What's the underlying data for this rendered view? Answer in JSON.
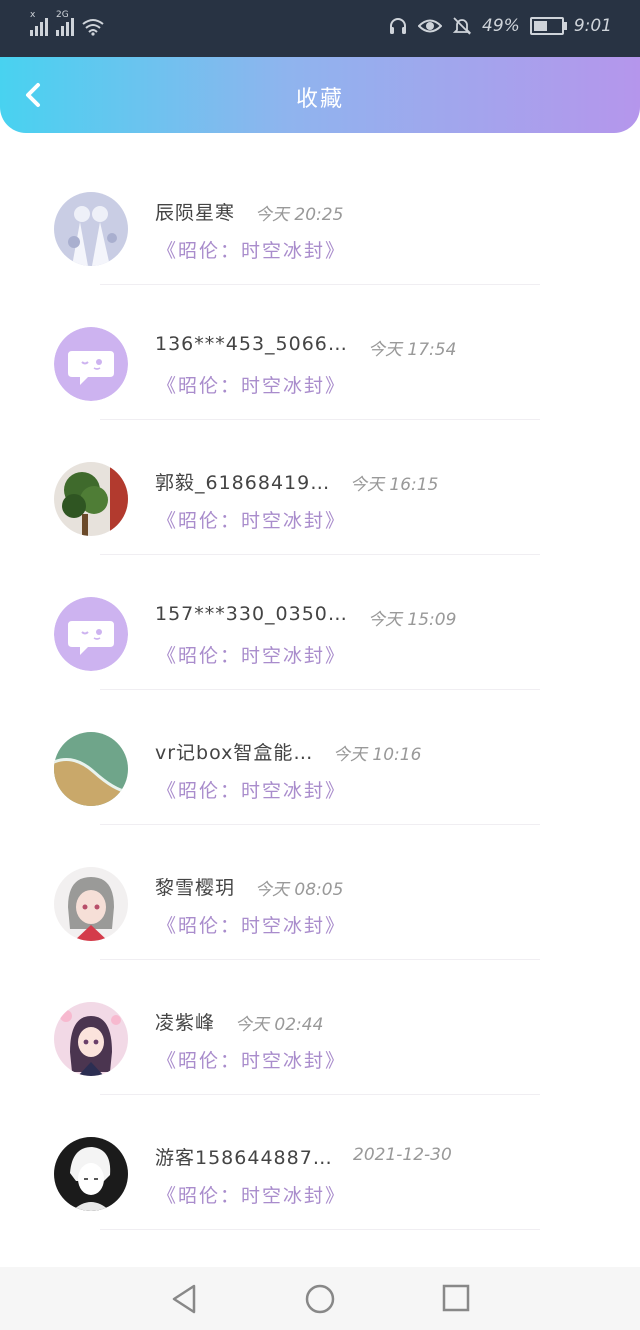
{
  "status_bar": {
    "signal1_tag": "x",
    "signal2_tag": "2G",
    "battery_percent": "49%",
    "battery_level": 0.49,
    "time": "9:01"
  },
  "header": {
    "title": "收藏",
    "gradient_start": "#48d2f0",
    "gradient_end": "#b596ec"
  },
  "items": [
    {
      "name": "辰陨星寒",
      "time": "今天  20:25",
      "book": "《昭伦：时空冰封》",
      "avatar": "anime-white-dress"
    },
    {
      "name": "136***453_5066…",
      "time": "今天  17:54",
      "book": "《昭伦：时空冰封》",
      "avatar": "default-chat-bubble"
    },
    {
      "name": "郭毅_61868419…",
      "time": "今天  16:15",
      "book": "《昭伦：时空冰封》",
      "avatar": "green-plant"
    },
    {
      "name": "157***330_0350…",
      "time": "今天  15:09",
      "book": "《昭伦：时空冰封》",
      "avatar": "default-chat-bubble"
    },
    {
      "name": "vr记box智盒能…",
      "time": "今天  10:16",
      "book": "《昭伦：时空冰封》",
      "avatar": "beach-waves"
    },
    {
      "name": "黎雪樱玥",
      "time": "今天  08:05",
      "book": "《昭伦：时空冰封》",
      "avatar": "anime-girl-grey"
    },
    {
      "name": "凌紫峰",
      "time": "今天  02:44",
      "book": "《昭伦：时空冰封》",
      "avatar": "anime-girl-sakura"
    },
    {
      "name": "游客158644887…",
      "time": "2021-12-30",
      "book": "《昭伦：时空冰封》",
      "avatar": "manga-boy-sketch"
    }
  ],
  "colors": {
    "book_title": "#a98ccc",
    "default_avatar": "#cdb3f0"
  }
}
